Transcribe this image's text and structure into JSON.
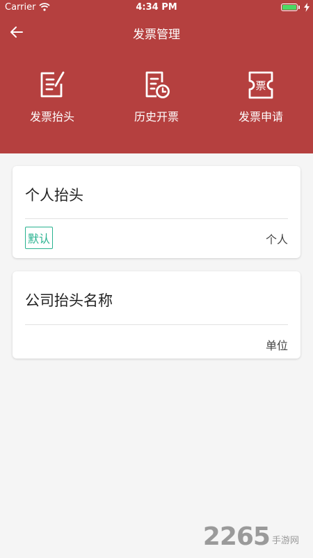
{
  "status_bar": {
    "carrier": "Carrier",
    "time": "4:34 PM"
  },
  "nav": {
    "title": "发票管理"
  },
  "actions": [
    {
      "label": "发票抬头",
      "icon": "invoice-header-icon"
    },
    {
      "label": "历史开票",
      "icon": "invoice-history-icon"
    },
    {
      "label": "发票申请",
      "icon": "invoice-apply-icon",
      "icon_text": "票"
    }
  ],
  "cards": [
    {
      "title": "个人抬头",
      "badge": "默认",
      "type": "个人"
    },
    {
      "title": "公司抬头名称",
      "type": "单位"
    }
  ],
  "watermark": {
    "number": "2265",
    "text": "手游网"
  },
  "colors": {
    "header": "#b5403f",
    "badge": "#28b28f",
    "background": "#f5f5f5"
  }
}
